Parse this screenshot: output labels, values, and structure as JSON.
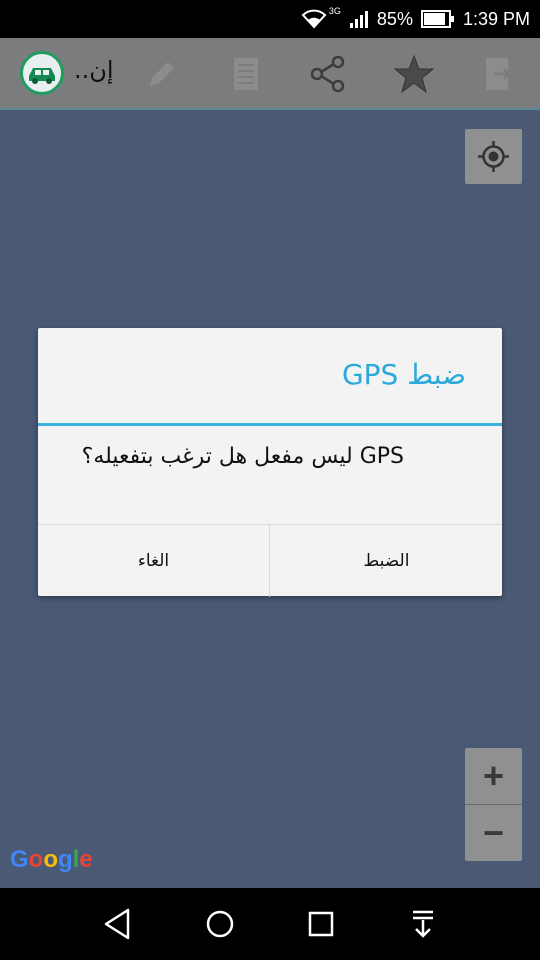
{
  "status_bar": {
    "network": "3G",
    "battery": "85%",
    "time": "1:39 PM"
  },
  "app_bar": {
    "title": "إن..",
    "icons": [
      "car-logo-icon",
      "edit-icon",
      "list-icon",
      "share-icon",
      "star-icon",
      "export-icon"
    ]
  },
  "map": {
    "zoom_in": "+",
    "zoom_out": "−",
    "attribution": {
      "letters": [
        "G",
        "o",
        "o",
        "g",
        "l",
        "e"
      ],
      "colors": [
        "#4285f4",
        "#ea4335",
        "#fbbc05",
        "#4285f4",
        "#34a853",
        "#ea4335"
      ]
    }
  },
  "dialog": {
    "title": "ضبط GPS",
    "message": "GPS ليس مفعل هل ترغب بتفعيله؟",
    "positive": "الضبط",
    "negative": "الغاء"
  },
  "nav_bar": {
    "icons": [
      "back-icon",
      "home-icon",
      "recents-icon",
      "notification-pull-icon"
    ]
  },
  "colors": {
    "accent": "#3db4e0",
    "map_bg": "#4a5a75",
    "app_bar": "#7a7c7e"
  }
}
